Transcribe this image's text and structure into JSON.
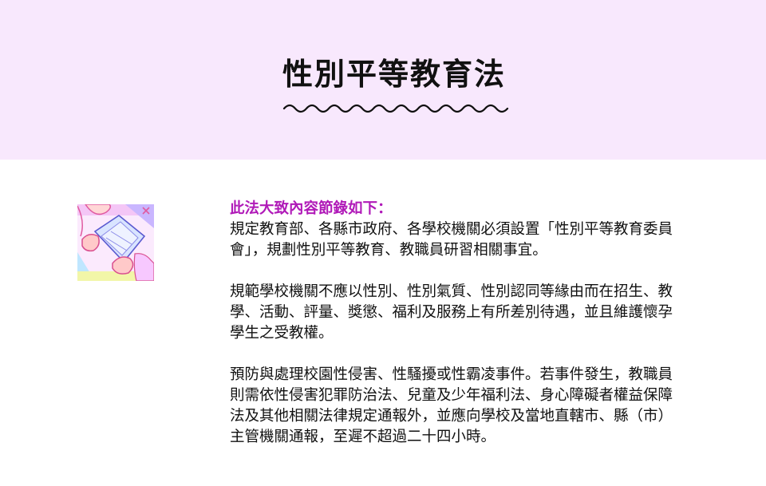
{
  "title": "性別平等教育法",
  "intro": "此法大致內容節錄如下：",
  "paragraphs": [
    "規定教育部、各縣市政府、各學校機關必須設置「性別平等教育委員會」，規劃性別平等教育、教職員研習相關事宜。",
    "規範學校機關不應以性別、性別氣質、性別認同等緣由而在招生、教學、活動、評量、獎懲、福利及服務上有所差別待遇，並且維護懷孕學生之受教權。",
    "預防與處理校園性侵害、性騷擾或性霸凌事件。若事件發生，教職員則需依性侵害犯罪防治法、兒童及少年福利法、身心障礙者權益保障法及其他相關法律規定通報外，並應向學校及當地直轄市、縣（市）主管機關通報，至遲不超過二十四小時。"
  ],
  "colors": {
    "header_background": "#f8e8fd",
    "intro_text": "#b01ab8",
    "body_text": "#111111"
  }
}
